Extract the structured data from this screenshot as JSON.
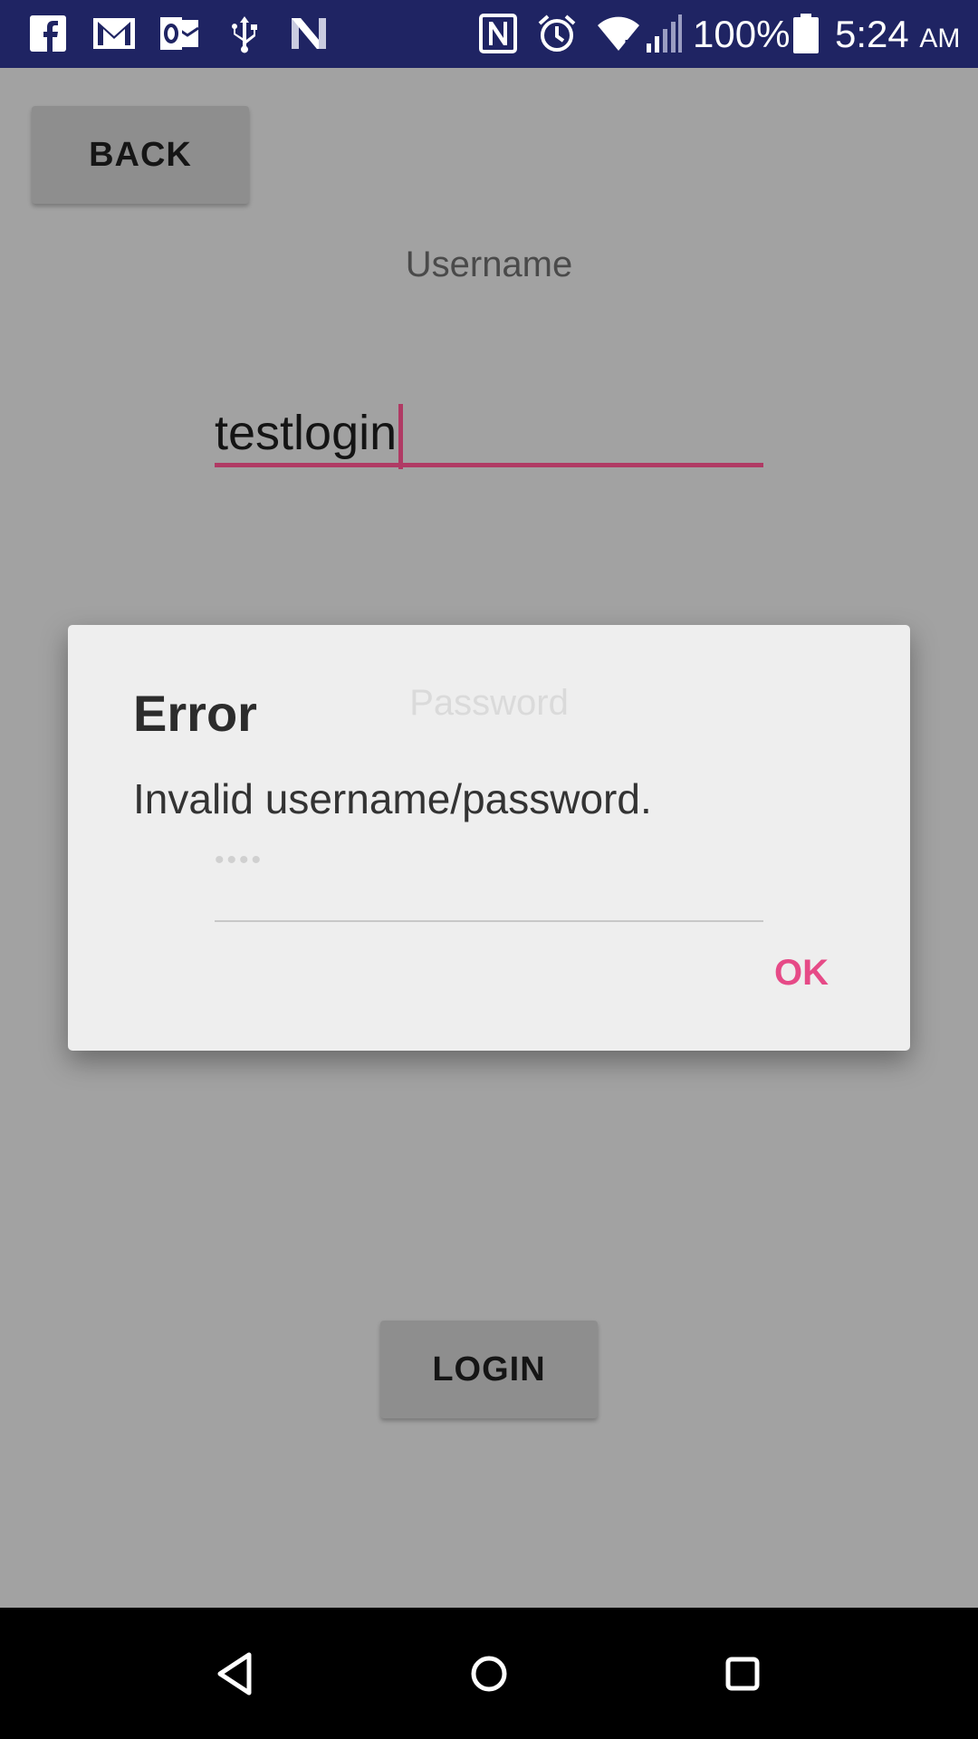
{
  "status_bar": {
    "icons": [
      "facebook-icon",
      "gmail-icon",
      "outlook-icon",
      "usb-icon",
      "n-icon",
      "nfc-icon",
      "alarm-icon",
      "wifi-icon",
      "signal-icon",
      "battery-icon"
    ],
    "battery_percent": "100%",
    "time": "5:24",
    "ampm": "AM"
  },
  "screen": {
    "back_label": "BACK",
    "username_label": "Username",
    "username_value": "testlogin",
    "password_label": "Password",
    "password_value": "••••",
    "login_label": "LOGIN"
  },
  "dialog": {
    "title": "Error",
    "message": "Invalid username/password.",
    "ok_label": "OK"
  },
  "nav_bar": {
    "buttons": [
      "back-nav-icon",
      "home-nav-icon",
      "recents-nav-icon"
    ]
  },
  "colors": {
    "status_bar": "#1f2463",
    "accent": "#e64a87",
    "field_underline": "#b03a64",
    "scrim": "#a2a2a2"
  }
}
